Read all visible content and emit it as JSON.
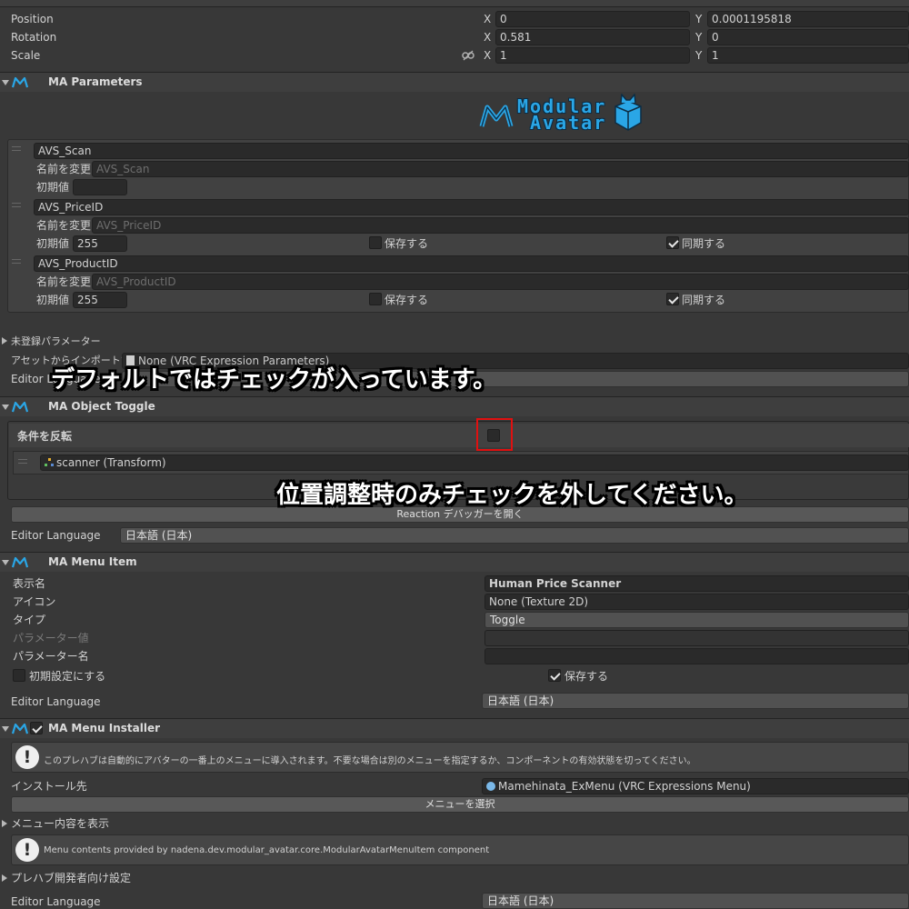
{
  "transform": {
    "position_label": "Position",
    "rotation_label": "Rotation",
    "scale_label": "Scale",
    "position": {
      "x": "0",
      "y": "0.0001195818"
    },
    "rotation": {
      "x": "0.581",
      "y": "0"
    },
    "scale": {
      "x": "1",
      "y": "1"
    },
    "axis_x": "X",
    "axis_y": "Y"
  },
  "ma_parameters": {
    "title": "MA Parameters",
    "logo_line1": "Modular",
    "logo_line2": "Avatar",
    "params": [
      {
        "name": "AVS_Scan",
        "rename_label": "名前を変更",
        "rename_placeholder": "AVS_Scan",
        "default_label": "初期値",
        "default_value": ""
      },
      {
        "name": "AVS_PriceID",
        "rename_label": "名前を変更",
        "rename_placeholder": "AVS_PriceID",
        "default_label": "初期値",
        "default_value": "255",
        "save_label": "保存する",
        "sync_label": "同期する"
      },
      {
        "name": "AVS_ProductID",
        "rename_label": "名前を変更",
        "rename_placeholder": "AVS_ProductID",
        "default_label": "初期値",
        "default_value": "255",
        "save_label": "保存する",
        "sync_label": "同期する"
      }
    ],
    "unregistered_label": "未登録パラメーター",
    "import_label": "アセットからインポートする",
    "import_value": "None (VRC Expression Parameters)",
    "editor_language_label": "Editor Language"
  },
  "overlay": {
    "note1": "デフォルトではチェックが入っています。",
    "note2": "位置調整時のみチェックを外してください。"
  },
  "ma_object_toggle": {
    "title": "MA Object Toggle",
    "invert_label": "条件を反転",
    "object_value": "scanner (Transform)",
    "reaction_button": "Reaction デバッガーを開く",
    "editor_language_label": "Editor Language",
    "editor_language_value": "日本語 (日本)"
  },
  "ma_menu_item": {
    "title": "MA Menu Item",
    "display_name_label": "表示名",
    "display_name_value": "Human Price Scanner",
    "icon_label": "アイコン",
    "icon_value": "None (Texture 2D)",
    "type_label": "タイプ",
    "type_value": "Toggle",
    "param_value_label": "パラメーター値",
    "param_name_label": "パラメーター名",
    "initial_label": "初期設定にする",
    "save_label": "保存する",
    "editor_language_label": "Editor Language",
    "editor_language_value": "日本語 (日本)"
  },
  "ma_menu_installer": {
    "title": "MA Menu Installer",
    "help_text": "このプレハブは自動的にアバターの一番上のメニューに導入されます。不要な場合は別のメニューを指定するか、コンポーネントの有効状態を切ってください。",
    "install_to_label": "インストール先",
    "install_to_value": "Mamehinata_ExMenu (VRC Expressions Menu)",
    "select_menu_button": "メニューを選択",
    "show_menu_label": "メニュー内容を表示",
    "menu_help_text": "Menu contents provided by nadena.dev.modular_avatar.core.ModularAvatarMenuItem component",
    "prefab_dev_label": "プレハブ開発者向け設定",
    "editor_language_label": "Editor Language",
    "editor_language_value": "日本語 (日本)"
  }
}
